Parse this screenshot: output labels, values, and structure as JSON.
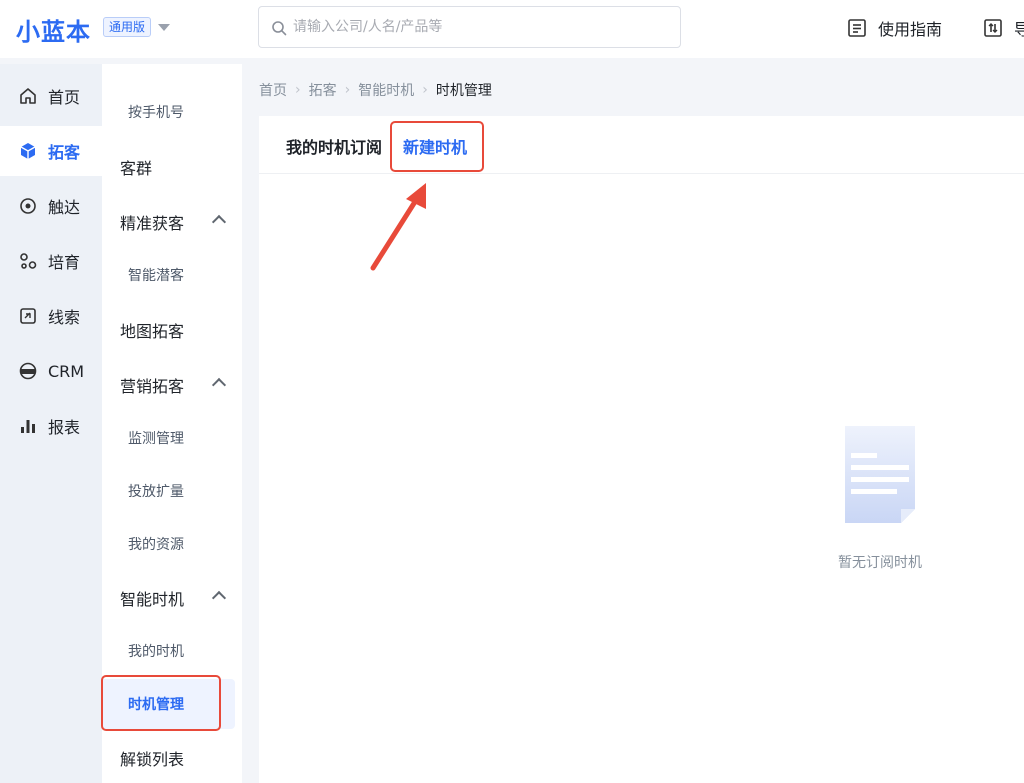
{
  "brand": {
    "logo": "小蓝本",
    "edition": "通用版"
  },
  "search": {
    "placeholder": "请输入公司/人名/产品等"
  },
  "header": {
    "guide": "使用指南",
    "export_partial": "导"
  },
  "nav1": [
    {
      "label": "首页",
      "icon": "home-icon"
    },
    {
      "label": "拓客",
      "icon": "cube-icon",
      "active": true
    },
    {
      "label": "触达",
      "icon": "target-icon"
    },
    {
      "label": "培育",
      "icon": "nurture-icon"
    },
    {
      "label": "线索",
      "icon": "lead-icon"
    },
    {
      "label": "CRM",
      "icon": "crm-icon"
    },
    {
      "label": "报表",
      "icon": "bar-chart-icon"
    }
  ],
  "nav2": {
    "phone": "按手机号",
    "customer_group": "客群",
    "precise": "精准获客",
    "smart_potential": "智能潜客",
    "map": "地图拓客",
    "marketing": "营销拓客",
    "monitor": "监测管理",
    "ads": "投放扩量",
    "resources": "我的资源",
    "smart_timing": "智能时机",
    "my_timing": "我的时机",
    "timing_manage": "时机管理",
    "unlock_list": "解锁列表"
  },
  "breadcrumb": [
    "首页",
    "拓客",
    "智能时机",
    "时机管理"
  ],
  "tabs": {
    "subscriptions": "我的时机订阅",
    "new_timing": "新建时机"
  },
  "empty": {
    "text": "暂无订阅时机"
  },
  "colors": {
    "accent": "#2c6bf2",
    "annotation": "#e84a3a"
  }
}
